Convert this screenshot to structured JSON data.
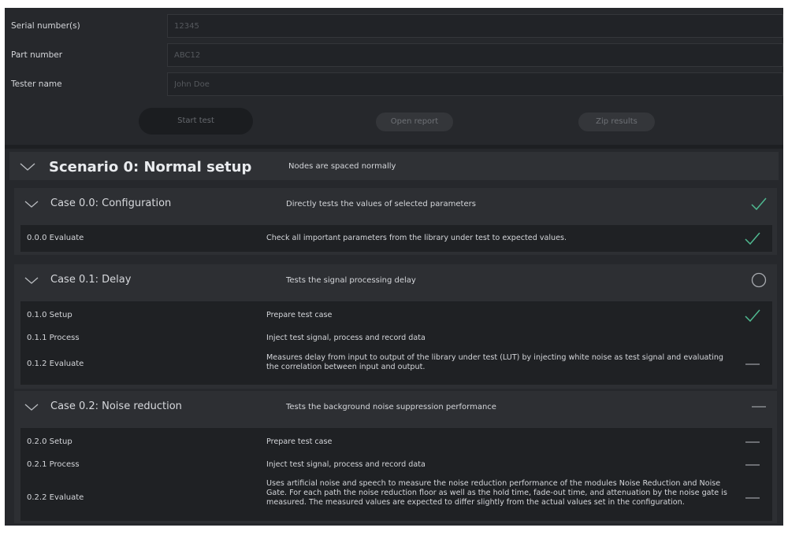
{
  "form": {
    "serial": {
      "label": "Serial number(s)",
      "placeholder": "12345"
    },
    "part": {
      "label": "Part number",
      "placeholder": "ABC12"
    },
    "tester": {
      "label": "Tester name",
      "placeholder": "John Doe"
    }
  },
  "buttons": {
    "start": "Start test",
    "open_report": "Open report",
    "zip_results": "Zip results"
  },
  "scenario": {
    "title": "Scenario 0: Normal setup",
    "description": "Nodes are spaced normally"
  },
  "cases": [
    {
      "title": "Case 0.0: Configuration",
      "description": "Directly tests the values of selected parameters",
      "status": "passed",
      "steps": [
        {
          "id": "0.0.0",
          "name": "Evaluate",
          "description": "Check all important parameters from the library under test to expected values.",
          "status": "passed"
        }
      ]
    },
    {
      "title": "Case 0.1: Delay",
      "description": "Tests the signal processing delay",
      "status": "running",
      "steps": [
        {
          "id": "0.1.0",
          "name": "Setup",
          "description": "Prepare test case",
          "status": "passed"
        },
        {
          "id": "0.1.1",
          "name": "Process",
          "description": "Inject test signal, process and record data",
          "status": "none"
        },
        {
          "id": "0.1.2",
          "name": "Evaluate",
          "description": "Measures delay from input to output of the library under test (LUT) by injecting white noise as test signal and evaluating the correlation between input and output.",
          "status": "pending"
        }
      ]
    },
    {
      "title": "Case 0.2: Noise reduction",
      "description": "Tests the background noise suppression performance",
      "status": "pending",
      "steps": [
        {
          "id": "0.2.0",
          "name": "Setup",
          "description": "Prepare test case",
          "status": "pending"
        },
        {
          "id": "0.2.1",
          "name": "Process",
          "description": "Inject test signal, process and record data",
          "status": "pending"
        },
        {
          "id": "0.2.2",
          "name": "Evaluate",
          "description": "Uses artificial noise and speech to measure the noise reduction performance of the modules Noise Reduction and Noise Gate. For each path the noise reduction floor as well as the hold time, fade-out time, and attenuation by the noise gate is measured. The measured values are expected to differ slightly from the actual values set in the configuration.",
          "status": "pending"
        }
      ]
    }
  ],
  "colors": {
    "background": "#26282c",
    "case_bg": "#2d2f33",
    "steps_bg": "#1f2124",
    "pass": "#4fb990",
    "pending": "#9a9da2",
    "running": "#a7aaaf"
  },
  "icons": {
    "passed": "checkmark-icon",
    "running": "circle-icon",
    "pending": "dash-icon",
    "collapse": "chevron-down-icon"
  }
}
